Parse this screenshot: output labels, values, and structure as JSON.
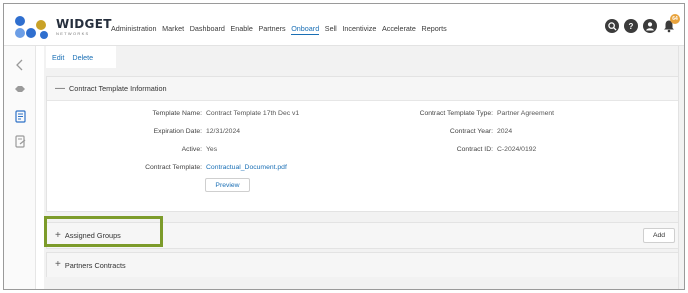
{
  "brand": {
    "name": "WIDGET",
    "sub": "NETWORKS"
  },
  "nav": [
    {
      "label": "Administration",
      "active": false
    },
    {
      "label": "Market",
      "active": false
    },
    {
      "label": "Dashboard",
      "active": false
    },
    {
      "label": "Enable",
      "active": false
    },
    {
      "label": "Partners",
      "active": false
    },
    {
      "label": "Onboard",
      "active": true
    },
    {
      "label": "Sell",
      "active": false
    },
    {
      "label": "Incentivize",
      "active": false
    },
    {
      "label": "Accelerate",
      "active": false
    },
    {
      "label": "Reports",
      "active": false
    }
  ],
  "header_icons": {
    "search": "search-icon",
    "help": "?",
    "user": "user-icon",
    "bell": "bell-icon",
    "notification_count": "64"
  },
  "actions": {
    "edit": "Edit",
    "delete": "Delete"
  },
  "info_panel": {
    "title": "Contract Template Information",
    "toggle": "—",
    "fields": {
      "template_name_label": "Template Name:",
      "template_name": "Contract Template 17th Dec v1",
      "expiration_label": "Expiration Date:",
      "expiration": "12/31/2024",
      "active_label": "Active:",
      "active": "Yes",
      "contract_template_label": "Contract Template:",
      "contract_template": "Contractual_Document.pdf",
      "type_label": "Contract Template Type:",
      "type": "Partner Agreement",
      "year_label": "Contract Year:",
      "year": "2024",
      "id_label": "Contract ID:",
      "id": "C-2024/0192"
    },
    "preview": "Preview"
  },
  "groups_panel": {
    "title": "Assigned Groups",
    "toggle": "+",
    "add": "Add"
  },
  "contracts_panel": {
    "title": "Partners Contracts",
    "toggle": "+"
  },
  "colors": {
    "accent": "#1a6fb5",
    "highlight": "#7c9b2a",
    "badge": "#e8a33d"
  }
}
